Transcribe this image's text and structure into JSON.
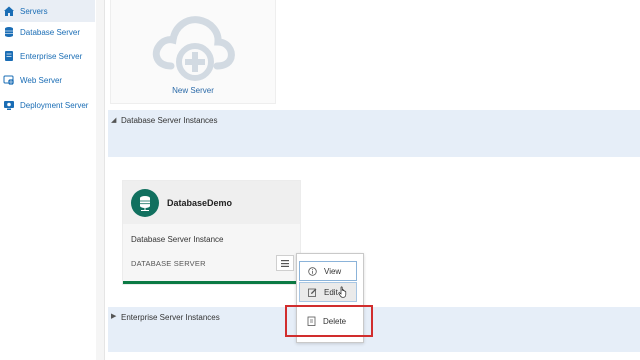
{
  "sidebar": {
    "items": [
      {
        "label": "Servers",
        "icon": "home-icon",
        "active": true
      },
      {
        "label": "Database Server",
        "icon": "database-icon"
      },
      {
        "label": "Enterprise Server",
        "icon": "enterprise-server-icon"
      },
      {
        "label": "Web Server",
        "icon": "globe-icon"
      },
      {
        "label": "Deployment Server",
        "icon": "deployment-icon"
      }
    ]
  },
  "new_server": {
    "label": "New Server",
    "icon": "cloud-plus-icon"
  },
  "sections": {
    "database": {
      "title": "Database Server Instances",
      "expanded": true
    },
    "enterprise": {
      "title": "Enterprise Server Instances",
      "expanded": false
    }
  },
  "db_card": {
    "name": "DatabaseDemo",
    "type_label": "Database Server Instance",
    "server_label": "DATABASE SERVER",
    "accent": "#11705f",
    "status_bar_color": "#0b7a44"
  },
  "context_menu": {
    "items": [
      {
        "label": "View",
        "icon": "info-icon"
      },
      {
        "label": "Edit",
        "icon": "edit-icon"
      },
      {
        "label": "Delete",
        "icon": "delete-icon"
      }
    ]
  },
  "colors": {
    "highlight": "#d12d2d",
    "link": "#1a6db5",
    "section_band": "#e6eef8"
  }
}
